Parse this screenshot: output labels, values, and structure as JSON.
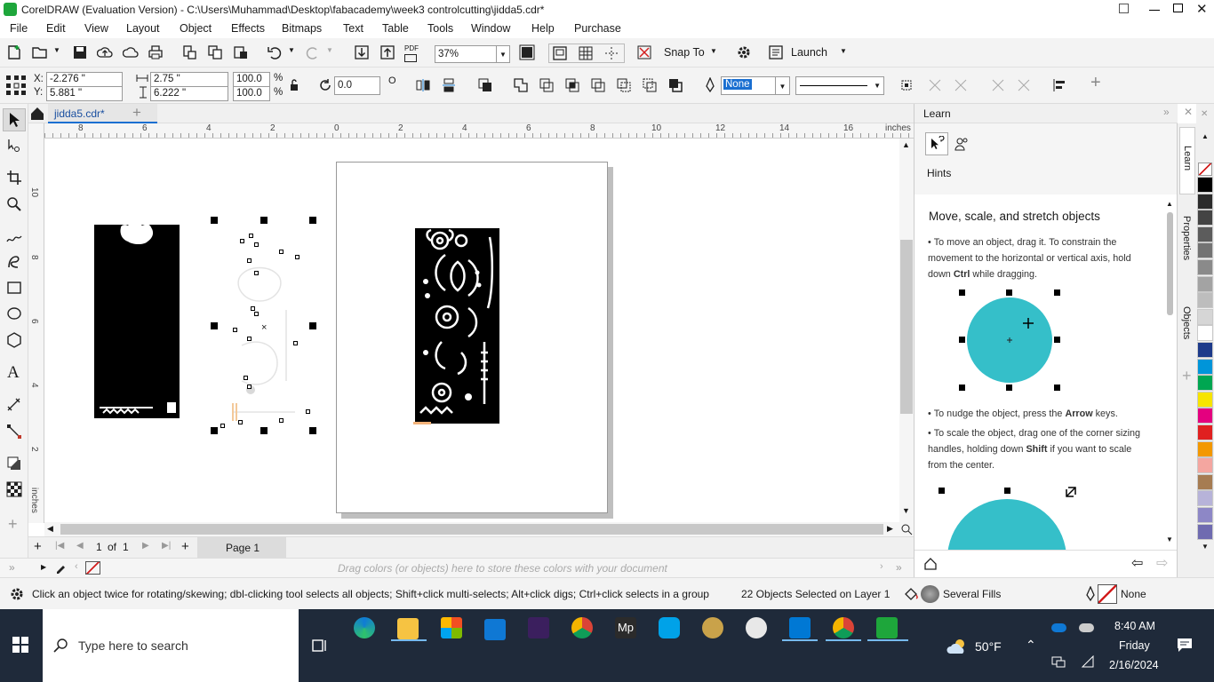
{
  "window": {
    "title": "CorelDRAW (Evaluation Version) - C:\\Users\\Muhammad\\Desktop\\fabacademy\\week3 controlcutting\\jidda5.cdr*"
  },
  "menu": [
    "File",
    "Edit",
    "View",
    "Layout",
    "Object",
    "Effects",
    "Bitmaps",
    "Text",
    "Table",
    "Tools",
    "Window",
    "Help",
    "Purchase"
  ],
  "toolbar": {
    "zoom": "37%",
    "snap_label": "Snap To",
    "launch_label": "Launch",
    "pdf_label": "PDF"
  },
  "props": {
    "x": "-2.276 \"",
    "y": "5.881 \"",
    "w": "2.75 \"",
    "h": "6.222 \"",
    "sx": "100.0",
    "sy": "100.0",
    "pct": "%",
    "pct2": "%",
    "angle": "0.0",
    "x_label": "X:",
    "y_label": "Y:",
    "outline": "None"
  },
  "doc_tab": "jidda5.cdr*",
  "ruler": {
    "h": [
      "8",
      "6",
      "4",
      "2",
      "0",
      "2",
      "4",
      "6",
      "8",
      "10",
      "12",
      "14",
      "16"
    ],
    "unit": "inches",
    "v": [
      "10",
      "8",
      "6",
      "4",
      "2"
    ],
    "vunit": "inches"
  },
  "pages": {
    "current": "1",
    "of": "of",
    "total": "1",
    "tab": "Page 1"
  },
  "palette_hint": "Drag colors (or objects) here to store these colors with your document",
  "learn": {
    "header": "Learn",
    "hints": "Hints",
    "heading": "Move, scale, and stretch objects",
    "b1_a": "To move an object, drag it. To constrain the movement to the horizontal or vertical axis, hold down ",
    "b1_key": "Ctrl",
    "b1_b": " while dragging.",
    "b2_a": "To nudge the object, press the ",
    "b2_key": "Arrow",
    "b2_b": " keys.",
    "b3_a": "To scale the object, drag one of the corner sizing handles, holding down ",
    "b3_key": "Shift",
    "b3_b": " if you want to scale from the center.",
    "accent": "#35bfc9"
  },
  "sidetabs": [
    "Learn",
    "Properties",
    "Objects"
  ],
  "palette_colors": [
    "#000000",
    "#2b2b2b",
    "#444444",
    "#5c5c5c",
    "#737373",
    "#8a8a8a",
    "#a3a3a3",
    "#bdbdbd",
    "#d6d6d6",
    "#ffffff",
    "#1d3a8a",
    "#0095d9",
    "#00a651",
    "#f7e400",
    "#e4007f",
    "#e02020",
    "#f39800",
    "#f4a6a0",
    "#a67c52",
    "#b7b3d9",
    "#8d87c6",
    "#6f6bb0"
  ],
  "status": {
    "hint": "Click an object twice for rotating/skewing; dbl-clicking tool selects all objects; Shift+click multi-selects; Alt+click digs; Ctrl+click selects in a group",
    "selection": "22 Objects Selected on Layer 1",
    "fill": "Several Fills",
    "outline": "None"
  },
  "taskbar": {
    "search": "Type here to search",
    "weather": "50°F",
    "time": "8:40 AM",
    "day": "Friday",
    "date": "2/16/2024"
  }
}
